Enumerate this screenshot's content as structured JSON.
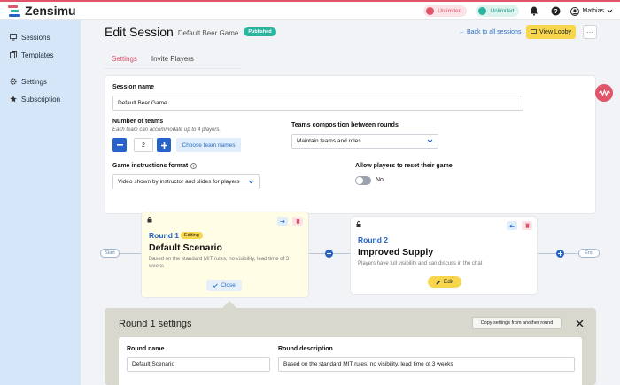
{
  "topbar": {
    "brand": "Zensimu",
    "pill1": "Unlimited",
    "pill2": "Unlimited",
    "user_name": "Mathias"
  },
  "sidebar": {
    "items": [
      {
        "label": "Sessions",
        "icon": "monitor-icon"
      },
      {
        "label": "Templates",
        "icon": "copy-icon"
      },
      {
        "label": "Settings",
        "icon": "gear-icon"
      },
      {
        "label": "Subscription",
        "icon": "star-icon"
      }
    ]
  },
  "header": {
    "title": "Edit Session",
    "subtitle": "Default Beer Game",
    "status": "Published",
    "back_link": "← Back to all sessions",
    "view_lobby": "View Lobby",
    "more": "···"
  },
  "tabs": [
    {
      "label": "Settings",
      "active": true
    },
    {
      "label": "Invite Players",
      "active": false
    }
  ],
  "form": {
    "session_name_label": "Session name",
    "session_name_value": "Default Beer Game",
    "teams_label": "Number of teams",
    "teams_hint": "Each team can accommodate up to 4 players.",
    "teams_value": "2",
    "choose_team_names": "Choose team names",
    "composition_label": "Teams composition between rounds",
    "composition_value": "Maintain teams and roles",
    "instructions_label": "Game instructions format",
    "instructions_value": "Video shown by instructor and slides for players",
    "reset_label": "Allow players to reset their game",
    "reset_value": "No"
  },
  "flow": {
    "start": "Start",
    "end": "End",
    "rounds": [
      {
        "name": "Round 1",
        "badge": "Editing",
        "title": "Default Scenario",
        "desc": "Based on the standard MIT rules, no visibility, lead time of 3 weeks",
        "action": "Close"
      },
      {
        "name": "Round 2",
        "title": "Improved Supply",
        "desc": "Players have full visibility and can discuss in the chat",
        "action": "Edit"
      }
    ]
  },
  "round_settings": {
    "title": "Round 1 settings",
    "copy_button": "Copy settings from another round",
    "round_name_label": "Round name",
    "round_name_value": "Default Scenario",
    "round_desc_label": "Round description",
    "round_desc_value": "Based on the standard MIT rules, no visibility, lead time of 3 weeks"
  },
  "colors": {
    "accent": "#e0556a",
    "primary": "#2563c9",
    "yellow": "#f7d64b",
    "sidebar": "#d4e6f7"
  }
}
